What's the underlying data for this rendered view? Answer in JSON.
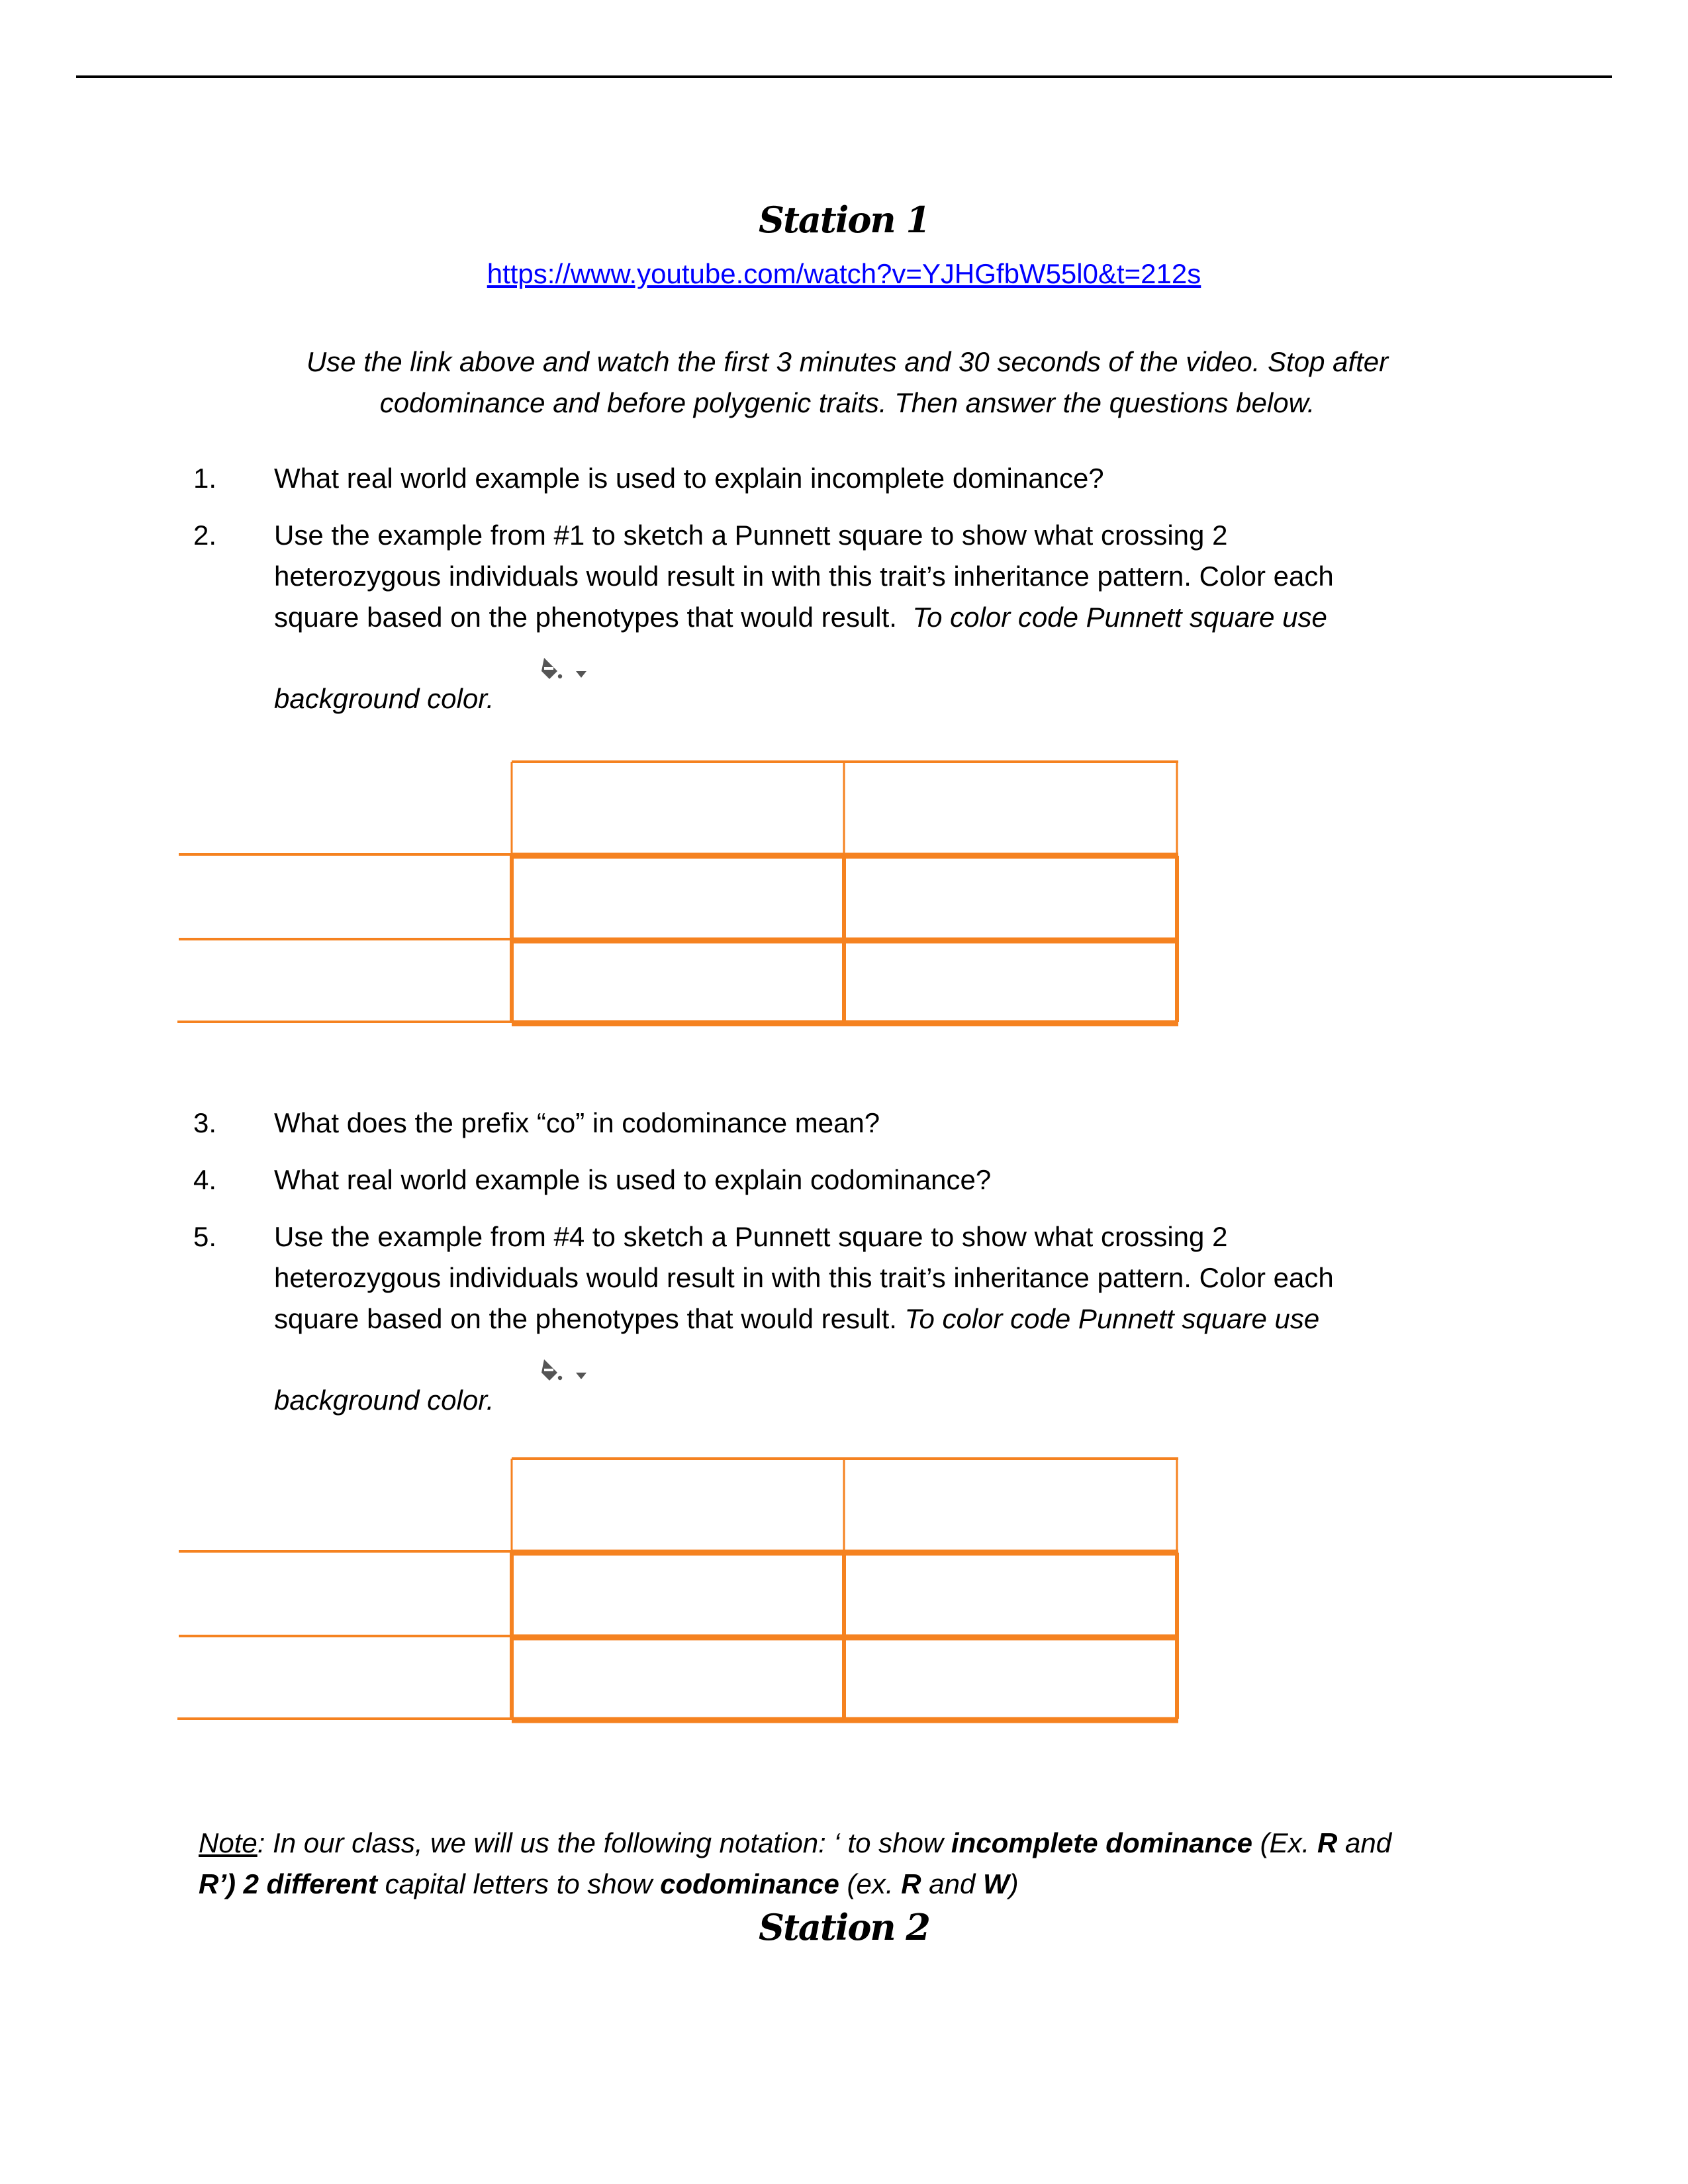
{
  "document": {
    "station1": {
      "title": "Station 1",
      "link": "https://www.youtube.com/watch?v=YJHGfbW55l0&t=212s",
      "instructions_line1": "Use the link above and watch the  first 3 minutes and 30 seconds of the video.  Stop after",
      "instructions_line2": "codominance and before polygenic traits. Then answer the questions below."
    },
    "questions": [
      {
        "num": "1.",
        "lines": [
          "What real world example is used to explain incomplete dominance?"
        ]
      },
      {
        "num": "2.",
        "lines": [
          "Use the example from #1 to sketch a Punnett square to show what crossing 2",
          "heterozygous individuals would result in with this trait’s inheritance pattern.  Color each"
        ],
        "line3_plain": "square based on the phenotypes that would result.  ",
        "line3_italic": "To color code Punnett square use",
        "tail": "background color."
      },
      {
        "num": "3.",
        "lines": [
          "What does the prefix “co” in codominance mean?"
        ]
      },
      {
        "num": "4.",
        "lines": [
          "What real world example is used to explain codominance?"
        ]
      },
      {
        "num": "5.",
        "lines": [
          "Use the example from #4 to sketch a Punnett square to show what crossing 2",
          "heterozygous individuals would result in with this trait’s inheritance pattern.  Color each"
        ],
        "line3_plain": "square based on the phenotypes that would result. ",
        "line3_italic": "To color code Punnett square use",
        "tail": "background color."
      }
    ],
    "icons": {
      "paint_bucket": "paint-bucket-icon",
      "dropdown": "chevron-down-icon"
    },
    "punnett_border_color": "#f58220",
    "note": {
      "label": "Note",
      "p1": ": In our class, we will us the following notation: ‘ to show ",
      "b1": "incomplete dominance",
      "p2": " (Ex. ",
      "b2": "R",
      "p3": " and",
      "b3": "R’) 2 different",
      "p4": " capital letters to show ",
      "b4": "codominance",
      "p5": " (ex. ",
      "b5": "R",
      "p6": " and ",
      "b6": "W",
      "p7": ")"
    },
    "station2": {
      "title": "Station 2"
    }
  }
}
